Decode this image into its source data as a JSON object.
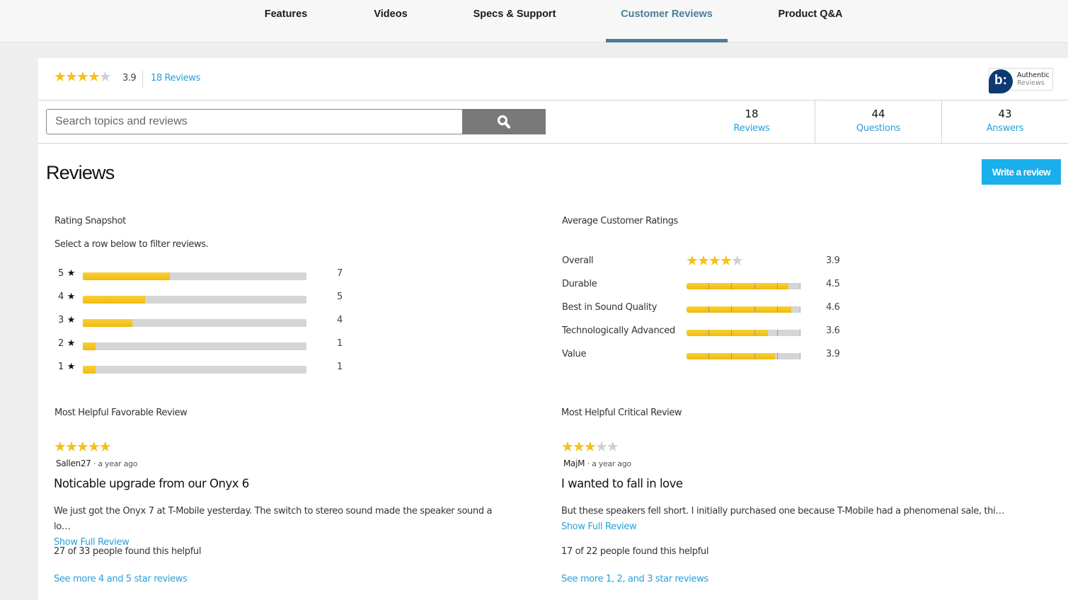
{
  "nav": {
    "tabs": [
      {
        "label": "Features",
        "active": false
      },
      {
        "label": "Videos",
        "active": false
      },
      {
        "label": "Specs & Support",
        "active": false
      },
      {
        "label": "Customer Reviews",
        "active": true
      },
      {
        "label": "Product Q&A",
        "active": false
      }
    ]
  },
  "colors": {
    "accent": "#4a7d98",
    "link": "#2a9fd8",
    "star": "#f4c118",
    "button": "#1aaeea"
  },
  "summary": {
    "rating": 3.9,
    "rating_text": "3.9",
    "reviews_link": "18 Reviews",
    "badge_line1": "Authentic",
    "badge_line2": "Reviews",
    "badge_logo": "b:"
  },
  "search": {
    "placeholder": "Search topics and reviews",
    "value": "",
    "icon": "search-icon"
  },
  "stats": [
    {
      "number": "18",
      "label": "Reviews"
    },
    {
      "number": "44",
      "label": "Questions"
    },
    {
      "number": "43",
      "label": "Answers"
    }
  ],
  "reviews_heading": "Reviews",
  "write_review_label": "Write a review",
  "snapshot": {
    "title": "Rating Snapshot",
    "instruction": "Select a row below to filter reviews.",
    "total": 18,
    "rows": [
      {
        "stars": "5",
        "count": 7
      },
      {
        "stars": "4",
        "count": 5
      },
      {
        "stars": "3",
        "count": 4
      },
      {
        "stars": "2",
        "count": 1
      },
      {
        "stars": "1",
        "count": 1
      }
    ]
  },
  "average_ratings": {
    "title": "Average Customer Ratings",
    "overall": {
      "label": "Overall",
      "value": 3.9,
      "value_text": "3.9"
    },
    "rows": [
      {
        "label": "Durable",
        "value": 4.5,
        "value_text": "4.5"
      },
      {
        "label": "Best in Sound Quality",
        "value": 4.6,
        "value_text": "4.6"
      },
      {
        "label": "Technologically Advanced",
        "value": 3.6,
        "value_text": "3.6"
      },
      {
        "label": "Value",
        "value": 3.9,
        "value_text": "3.9"
      }
    ]
  },
  "favorable": {
    "section_label": "Most Helpful Favorable Review",
    "rating": 5,
    "author": "Sallen27",
    "ago": "· a year ago",
    "title": "Noticable upgrade from our Onyx 6",
    "body": "We just got the Onyx 7 at T-Mobile yesterday. The switch to stereo sound made the speaker sound a lo…",
    "show_full": "Show Full Review",
    "helpful": "27 of 33 people found this helpful",
    "see_more": "See more 4 and 5 star reviews"
  },
  "critical": {
    "section_label": "Most Helpful Critical Review",
    "rating": 3,
    "author": "MajM",
    "ago": "· a year ago",
    "title": "I wanted to fall in love",
    "body": "But these speakers fell short. I initially purchased one because T-Mobile had a phenomenal sale, thi…",
    "show_full": "Show Full Review",
    "helpful": "17 of 22 people found this helpful",
    "see_more": "See more 1, 2, and 3 star reviews"
  }
}
